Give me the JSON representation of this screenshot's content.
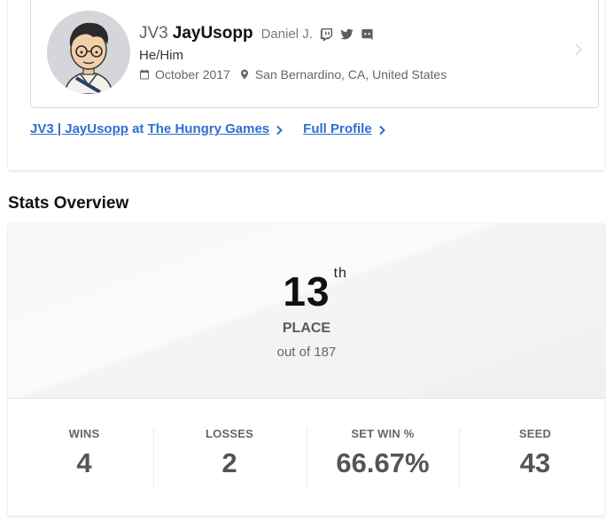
{
  "profile": {
    "prefix": "JV3",
    "gamertag": "JayUsopp",
    "real_name": "Daniel J.",
    "pronouns": "He/Him",
    "joined": "October 2017",
    "location": "San Bernardino, CA, United States",
    "socials": [
      "twitch-icon",
      "twitter-icon",
      "discord-icon"
    ]
  },
  "links": {
    "entrant_name": "JV3 | JayUsopp",
    "at_word": " at ",
    "event_name": "The Hungry Games",
    "full_profile": "Full Profile"
  },
  "stats_section": {
    "title": "Stats Overview",
    "place_number": "13",
    "place_suffix": "th",
    "place_label": "PLACE",
    "out_of": "out of 187"
  },
  "stats": [
    {
      "label": "WINS",
      "value": "4"
    },
    {
      "label": "LOSSES",
      "value": "2"
    },
    {
      "label": "SET WIN %",
      "value": "66.67%"
    },
    {
      "label": "SEED",
      "value": "43"
    }
  ]
}
